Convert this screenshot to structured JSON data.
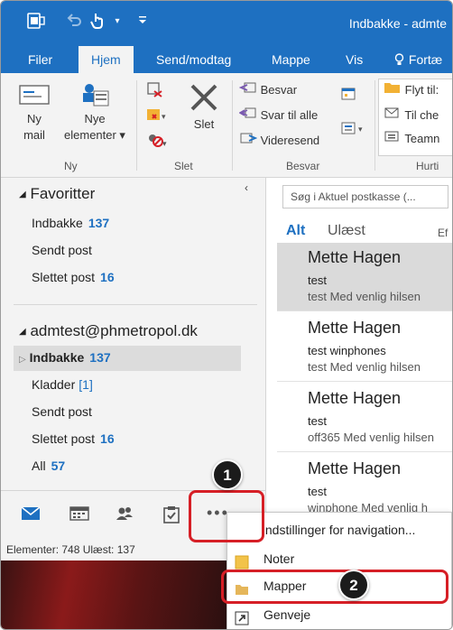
{
  "titlebar": {
    "title": "Indbakke - admte"
  },
  "tabs": [
    "Filer",
    "Hjem",
    "Send/modtag",
    "Mappe",
    "Vis",
    "Fortæ"
  ],
  "ribbon": {
    "ny": {
      "ny_mail": "Ny\nmail",
      "nye_elementer": "Nye\nelementer",
      "label": "Ny"
    },
    "slet": {
      "slet_button": "Slet",
      "label": "Slet"
    },
    "besvar": {
      "besvar": "Besvar",
      "svar_til_alle": "Svar til alle",
      "videresend": "Videresend",
      "label": "Besvar"
    },
    "hurtig": {
      "flyt": "Flyt til:",
      "til_che": "Til che",
      "teamm": "Teamn",
      "label": "Hurti"
    }
  },
  "nav": {
    "favoritter": "Favoritter",
    "fav_items": [
      {
        "label": "Indbakke",
        "count": "137"
      },
      {
        "label": "Sendt post",
        "count": ""
      },
      {
        "label": "Slettet post",
        "count": "16"
      }
    ],
    "account": "admtest@phmetropol.dk",
    "acct_items": [
      {
        "label": "Indbakke",
        "count": "137"
      },
      {
        "label": "Kladder",
        "count": "[1]"
      },
      {
        "label": "Sendt post",
        "count": ""
      },
      {
        "label": "Slettet post",
        "count": "16"
      },
      {
        "label": "All",
        "count": "57"
      }
    ]
  },
  "messages": {
    "search_placeholder": "Søg i Aktuel postkasse (...",
    "filter_all": "Alt",
    "filter_unread": "Ulæst",
    "filter_more": "Ef",
    "items": [
      {
        "from": "Mette Hagen",
        "subject": "test",
        "preview": "test  Med venlig hilsen"
      },
      {
        "from": "Mette Hagen",
        "subject": "test winphones",
        "preview": "test  Med venlig hilsen"
      },
      {
        "from": "Mette Hagen",
        "subject": "test",
        "preview": "off365  Med venlig hilsen"
      },
      {
        "from": "Mette Hagen",
        "subject": "test",
        "preview": "winphone  Med venlig h"
      }
    ]
  },
  "status": {
    "text": "Elementer: 748     Ulæst: 137"
  },
  "popup": {
    "items": [
      "Indstillinger for navigation...",
      "Noter",
      "Mapper",
      "Genveje"
    ]
  },
  "callouts": {
    "one": "1",
    "two": "2"
  },
  "colors": {
    "accent": "#1e70c1",
    "callout": "#d61f26"
  }
}
